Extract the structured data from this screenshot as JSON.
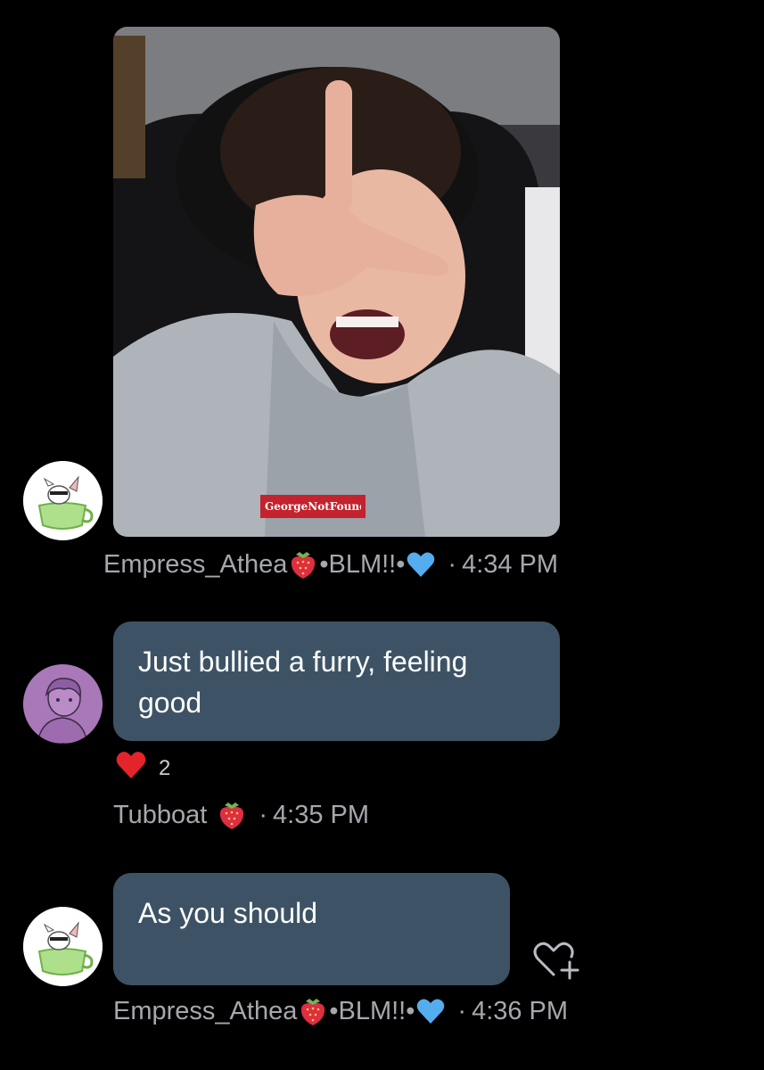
{
  "messages": [
    {
      "sender": "Empress_Athea",
      "badge_text": "•BLM!!•",
      "separator": "·",
      "time": "4:34 PM",
      "attachment": "photo",
      "photo_caption_print": "GeorgeNotFound"
    },
    {
      "sender": "Tubboat",
      "separator": "·",
      "time": "4:35 PM",
      "text": "Just bullied a furry, feeling good",
      "reaction": {
        "icon": "heart-icon",
        "count": "2"
      }
    },
    {
      "sender": "Empress_Athea",
      "badge_text": "•BLM!!•",
      "separator": "·",
      "time": "4:36 PM",
      "text": "As you should",
      "action": "add-reaction-icon"
    }
  ],
  "colors": {
    "background": "#000000",
    "bubble": "#3d5365",
    "meta_text": "#a5a8ad",
    "heart_red": "#e3242b",
    "heart_blue": "#55acee",
    "strawberry": "#dd2e44"
  }
}
